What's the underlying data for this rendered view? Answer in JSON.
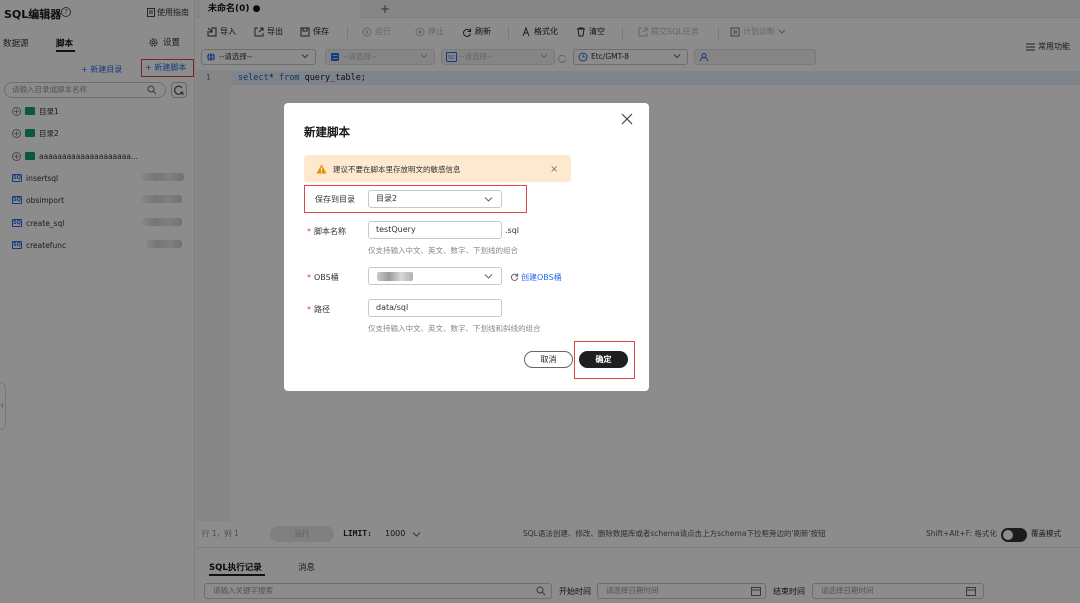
{
  "left_panel": {
    "title": "SQL编辑器",
    "help_icon_text": "?",
    "guide_label": "使用指南",
    "tabs": [
      "数据源",
      "脚本"
    ],
    "active_tab": "脚本",
    "settings_label": "设置",
    "new_dir_label": "+ 新建目录",
    "new_script_label": "+ 新建脚本",
    "search_placeholder": "请输入目录或脚本名称",
    "tree": {
      "folders": [
        "目录1",
        "目录2",
        "aaaaaaaaaaaaaaaaaaaa..."
      ],
      "scripts": [
        "insertsql",
        "obsimport",
        "create_sql",
        "createfunc"
      ],
      "script_icon_text": "SQ"
    }
  },
  "editor": {
    "tab_title": "未命名(0) ●",
    "add_tab": "+",
    "toolbar": {
      "import": "导入",
      "export": "导出",
      "save": "保存",
      "run": "运行",
      "stop": "停止",
      "refresh": "刷新",
      "format": "格式化",
      "clear": "清空",
      "submit": "提交SQL任务",
      "diagnose": "计划诊断"
    },
    "favorites": "常用功能",
    "selectors": {
      "datasource": "--请选择--",
      "database": "--请选择--",
      "schema": "--请选择--",
      "timezone": "Etc/GMT-8"
    },
    "line_number": "1",
    "code": {
      "kw1": "select",
      "mid": "* ",
      "kw2": "from",
      "rest": " query_table;"
    }
  },
  "status_bar": {
    "position": "行 1，列 1",
    "run_label": "运行",
    "limit_label": "LIMIT:",
    "limit_value": "1000",
    "hint": "SQL语法创建、修改、删除数据库或者schema请点击上方schema下拉框旁边的'刷新'按钮",
    "shortcut": "Shift+Alt+F: 格式化",
    "overwrite_label": "覆盖模式"
  },
  "bottom_panel": {
    "tabs": [
      "SQL执行记录",
      "消息"
    ],
    "search_placeholder": "请输入关键字搜索",
    "start_label": "开始时间",
    "end_label": "结束时间",
    "date_placeholder": "请选择日期时间"
  },
  "dialog": {
    "title": "新建脚本",
    "warning": "建议不要在脚本里存放明文的敏感信息",
    "dir_label": "保存到目录",
    "dir_value": "目录2",
    "name_label": "脚本名称",
    "name_value": "testQuery",
    "name_suffix": ".sql",
    "name_hint": "仅支持输入中文、英文、数字、下划线的组合",
    "obs_label": "OBS桶",
    "obs_value": "",
    "obs_create": "创建OBS桶",
    "path_label": "路径",
    "path_value": "data/sql",
    "path_hint": "仅支持输入中文、英文、数字、下划线和斜线的组合",
    "required_mark": "*",
    "cancel_label": "取消",
    "ok_label": "确定"
  },
  "colors": {
    "accent_blue": "#2869e8",
    "highlight_red": "#e04646",
    "primary_button": "#1f1f1f",
    "warning_bg": "#fde9d0",
    "folder_green": "#12a26a"
  }
}
